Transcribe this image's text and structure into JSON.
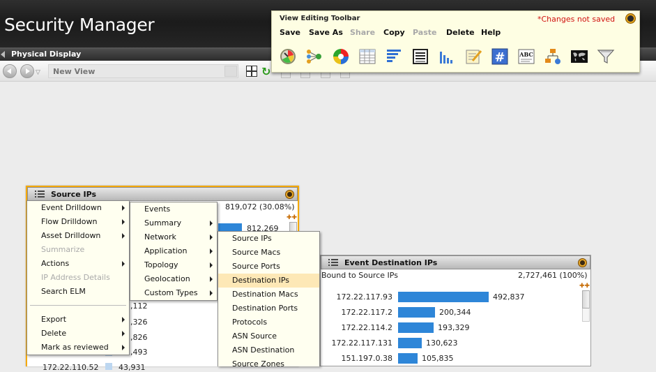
{
  "header": {
    "app_title": "Security Manager"
  },
  "tab": {
    "label": "Physical Display"
  },
  "nav": {
    "view_name_placeholder": "New View",
    "dropdown_glyph": "▽"
  },
  "toolbar": {
    "title": "View Editing Toolbar",
    "status": "*Changes not saved",
    "menu": [
      {
        "label": "Save",
        "enabled": true
      },
      {
        "label": "Save As",
        "enabled": true
      },
      {
        "label": "Share",
        "enabled": false
      },
      {
        "label": "Copy",
        "enabled": true
      },
      {
        "label": "Paste",
        "enabled": false
      },
      {
        "label": "Delete",
        "enabled": true
      },
      {
        "label": "Help",
        "enabled": true
      }
    ],
    "icons": [
      "dial-gauge-icon",
      "node-graph-icon",
      "pie-chart-icon",
      "table-icon",
      "bar-chart-horizontal-icon",
      "list-grid-icon",
      "bar-chart-vertical-icon",
      "note-edit-icon",
      "number-counter-icon",
      "text-label-icon",
      "topology-icon",
      "world-map-icon",
      "filter-funnel-icon"
    ],
    "icon_text": {
      "abc": "ABC",
      "hash": "#"
    }
  },
  "source_panel": {
    "title": "Source IPs",
    "summary_value": "819,072 (30.08%)",
    "top_bar_value": "812,269",
    "partial_values": [
      ",112",
      ",326",
      ",826",
      ",493"
    ],
    "bottom_label": "172.22.110.52",
    "bottom_value": "43,931"
  },
  "context_menu_1": {
    "items": [
      {
        "label": "Event Drilldown",
        "submenu": true,
        "enabled": true
      },
      {
        "label": "Flow Drilldown",
        "submenu": true,
        "enabled": true
      },
      {
        "label": "Asset Drilldown",
        "submenu": true,
        "enabled": true
      },
      {
        "label": "Summarize",
        "submenu": false,
        "enabled": false
      },
      {
        "label": "Actions",
        "submenu": true,
        "enabled": true
      },
      {
        "label": "IP Address Details",
        "submenu": false,
        "enabled": false
      },
      {
        "label": "Search ELM",
        "submenu": false,
        "enabled": true
      },
      {
        "label": "Export",
        "submenu": true,
        "enabled": true
      },
      {
        "label": "Delete",
        "submenu": true,
        "enabled": true
      },
      {
        "label": "Mark as reviewed",
        "submenu": true,
        "enabled": true
      }
    ]
  },
  "context_menu_2": {
    "items": [
      {
        "label": "Events",
        "submenu": false
      },
      {
        "label": "Summary",
        "submenu": true
      },
      {
        "label": "Network",
        "submenu": true
      },
      {
        "label": "Application",
        "submenu": true
      },
      {
        "label": "Topology",
        "submenu": true
      },
      {
        "label": "Geolocation",
        "submenu": true
      },
      {
        "label": "Custom Types",
        "submenu": true
      }
    ]
  },
  "context_menu_3": {
    "items": [
      {
        "label": "Source IPs",
        "highlighted": false
      },
      {
        "label": "Source Macs",
        "highlighted": false
      },
      {
        "label": "Source Ports",
        "highlighted": false
      },
      {
        "label": "Destination IPs",
        "highlighted": true
      },
      {
        "label": "Destination Macs",
        "highlighted": false
      },
      {
        "label": "Destination Ports",
        "highlighted": false
      },
      {
        "label": "Protocols",
        "highlighted": false
      },
      {
        "label": "ASN Source",
        "highlighted": false
      },
      {
        "label": "ASN Destination",
        "highlighted": false
      },
      {
        "label": "Source Zones",
        "highlighted": false
      }
    ]
  },
  "destination_panel": {
    "title": "Event Destination IPs",
    "bound_label": "Bound to Source IPs",
    "total": "2,727,461 (100%)",
    "rows": [
      {
        "ip": "172.22.117.93",
        "count": "492,837",
        "value": 492837
      },
      {
        "ip": "172.22.117.2",
        "count": "200,344",
        "value": 200344
      },
      {
        "ip": "172.22.114.2",
        "count": "193,329",
        "value": 193329
      },
      {
        "ip": "172.22.117.131",
        "count": "130,623",
        "value": 130623
      },
      {
        "ip": "151.197.0.38",
        "count": "105,835",
        "value": 105835
      }
    ]
  },
  "colors": {
    "accent": "#f5a900",
    "bar": "#2e86d8",
    "warning_text": "#d1110f",
    "highlight": "#fde8b6"
  }
}
